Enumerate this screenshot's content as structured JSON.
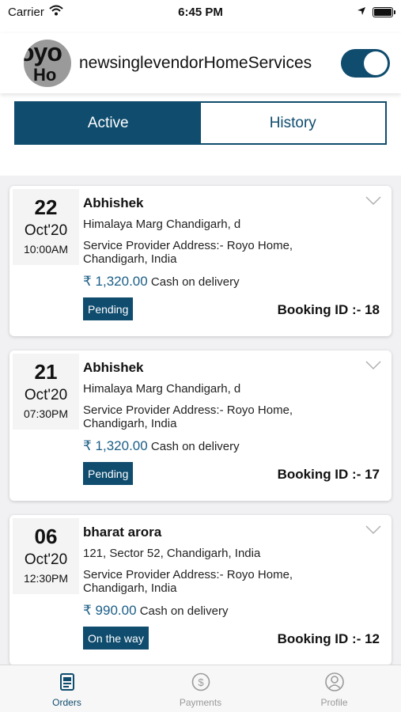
{
  "status_bar": {
    "carrier": "Carrier",
    "time": "6:45 PM"
  },
  "header": {
    "logo_text_top": "oyo",
    "logo_text_bottom": "Ho",
    "title": "newsinglevendorHomeServices",
    "toggle_on": true
  },
  "segments": {
    "active": "Active",
    "history": "History"
  },
  "orders": [
    {
      "day": "22",
      "month": "Oct'20",
      "time": "10:00AM",
      "name": "Abhishek",
      "address": "Himalaya Marg Chandigarh, d",
      "sp_line1": "Service Provider Address:- Royo Home,",
      "sp_line2": "Chandigarh, India",
      "price": "₹ 1,320.00",
      "payment": "Cash on delivery",
      "status": "Pending",
      "booking": "Booking ID :- 18"
    },
    {
      "day": "21",
      "month": "Oct'20",
      "time": "07:30PM",
      "name": "Abhishek",
      "address": "Himalaya Marg Chandigarh, d",
      "sp_line1": "Service Provider Address:- Royo Home,",
      "sp_line2": "Chandigarh, India",
      "price": "₹ 1,320.00",
      "payment": "Cash on delivery",
      "status": "Pending",
      "booking": "Booking ID :- 17"
    },
    {
      "day": "06",
      "month": "Oct'20",
      "time": "12:30PM",
      "name": "bharat arora",
      "address": "121, Sector 52, Chandigarh, India",
      "sp_line1": "Service Provider Address:- Royo Home,",
      "sp_line2": "Chandigarh, India",
      "price": "₹ 990.00",
      "payment": "Cash on delivery",
      "status": "On the way",
      "booking": "Booking ID :- 12"
    }
  ],
  "tabs": {
    "orders": "Orders",
    "payments": "Payments",
    "profile": "Profile"
  },
  "colors": {
    "brand": "#0f4c6e",
    "price": "#1b5e86"
  }
}
